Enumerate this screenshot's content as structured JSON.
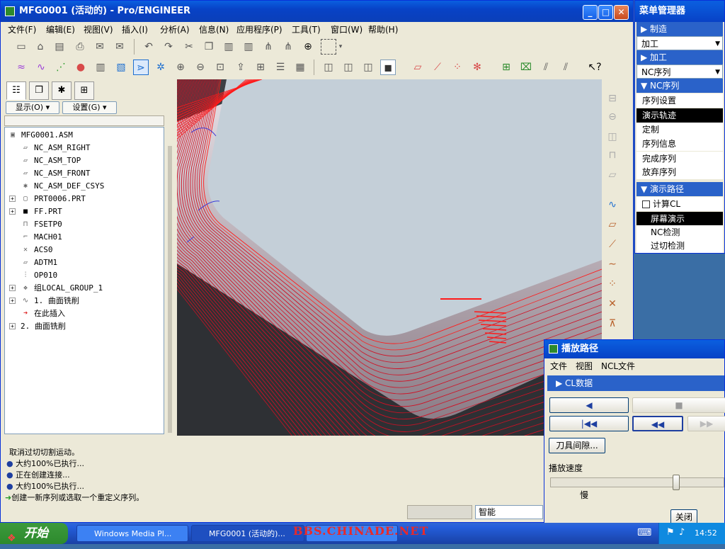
{
  "window": {
    "title": "MFG0001 (活动的) - Pro/ENGINEER",
    "min": "_",
    "max": "□",
    "close": "✕"
  },
  "menubar": [
    "文件(F)",
    "编辑(E)",
    "视图(V)",
    "插入(I)",
    "分析(A)",
    "信息(N)",
    "应用程序(P)",
    "工具(T)",
    "窗口(W)",
    "帮助(H)"
  ],
  "left_panel": {
    "display_dd": "显示(O) ▾",
    "settings_dd": "设置(G) ▾"
  },
  "tree": [
    {
      "label": "MFG0001.ASM",
      "icon": "assembly-icon",
      "glyph": "▣"
    },
    {
      "label": "NC_ASM_RIGHT",
      "icon": "datum-plane-icon",
      "glyph": "▱"
    },
    {
      "label": "NC_ASM_TOP",
      "icon": "datum-plane-icon",
      "glyph": "▱"
    },
    {
      "label": "NC_ASM_FRONT",
      "icon": "datum-plane-icon",
      "glyph": "▱"
    },
    {
      "label": "NC_ASM_DEF_CSYS",
      "icon": "csys-icon",
      "glyph": "✱"
    },
    {
      "label": "PRT0006.PRT",
      "icon": "part-icon",
      "glyph": "▢"
    },
    {
      "label": "FF.PRT",
      "icon": "part-icon",
      "glyph": "■"
    },
    {
      "label": "FSETP0",
      "icon": "fixture-icon",
      "glyph": "⊓"
    },
    {
      "label": "MACH01",
      "icon": "machine-icon",
      "glyph": "⌐"
    },
    {
      "label": "ACS0",
      "icon": "csys-icon",
      "glyph": "✕"
    },
    {
      "label": "ADTM1",
      "icon": "datum-plane-icon",
      "glyph": "▱"
    },
    {
      "label": "OP010",
      "icon": "operation-icon",
      "glyph": "⫶"
    },
    {
      "label": "组LOCAL_GROUP_1",
      "icon": "group-icon",
      "glyph": "❖"
    },
    {
      "label": "1. 曲面铣削",
      "icon": "surface-mill-icon",
      "glyph": "∿"
    },
    {
      "label": "在此插入",
      "icon": "insert-arrow-icon",
      "glyph": "➜"
    },
    {
      "label": "2. 曲面铣削",
      "icon": "",
      "glyph": ""
    }
  ],
  "messages": [
    {
      "bullet": "",
      "text": "取消过切切割运动。"
    },
    {
      "bullet": "●",
      "text": "大约100%已执行..."
    },
    {
      "bullet": "●",
      "text": "正在创建连接..."
    },
    {
      "bullet": "●",
      "text": "大约100%已执行..."
    },
    {
      "bullet": "➜",
      "text": "创建一新序列或选取一个重定义序列。"
    }
  ],
  "status": {
    "filter": "智能"
  },
  "menu_manager": {
    "title": "菜单管理器",
    "hdr_make": "▶ 制造",
    "sel_machining": "加工",
    "hdr_machining": "▶ 加工",
    "sel_nc": "NC序列",
    "hdr_nc": "▼ NC序列",
    "items_nc": [
      "序列设置",
      "演示轨迹",
      "定制",
      "序列信息",
      "完成序列",
      "放弃序列"
    ],
    "hdr_demo": "▼ 演示路径",
    "calc_cl": "计算CL",
    "items_demo": [
      "屏幕演示",
      "NC检测",
      "过切检测"
    ]
  },
  "play_path": {
    "title": "播放路径",
    "menu": [
      "文件",
      "视图",
      "NCL文件"
    ],
    "cl_data": "▶ CL数据",
    "btn_back": "◀",
    "btn_stop": "■",
    "btn_start": "|◀◀",
    "btn_rewind": "◀◀",
    "btn_ff": "▶▶",
    "tool_clearance": "刀具间隙...",
    "speed_label": "播放速度",
    "slow": "慢",
    "speed": 0.73,
    "close": "关闭"
  },
  "taskbar": {
    "start": "开始",
    "tasks": [
      "Windows Media Pl...",
      "MFG0001 (活动的)..."
    ],
    "clock": "14:52"
  },
  "watermark": "BBS.CHINADE.NET"
}
